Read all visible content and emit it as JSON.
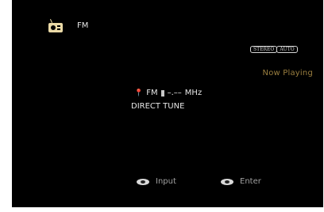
{
  "source": {
    "icon": "radio-icon",
    "label": "FM"
  },
  "badges": [
    "STEREO",
    "AUTO"
  ],
  "now_playing": "Now Playing",
  "tuner": {
    "pin_icon": "location-pin-icon",
    "band": "FM",
    "frequency": "–.––",
    "unit": "MHz",
    "mode": "DIRECT TUNE"
  },
  "hints": {
    "input": {
      "icon": "input-knob-icon",
      "label": "Input"
    },
    "enter": {
      "icon": "enter-knob-icon",
      "label": "Enter"
    }
  },
  "colors": {
    "accent": "#9a7e3f",
    "icon": "#ead9a6",
    "background": "#000000"
  }
}
